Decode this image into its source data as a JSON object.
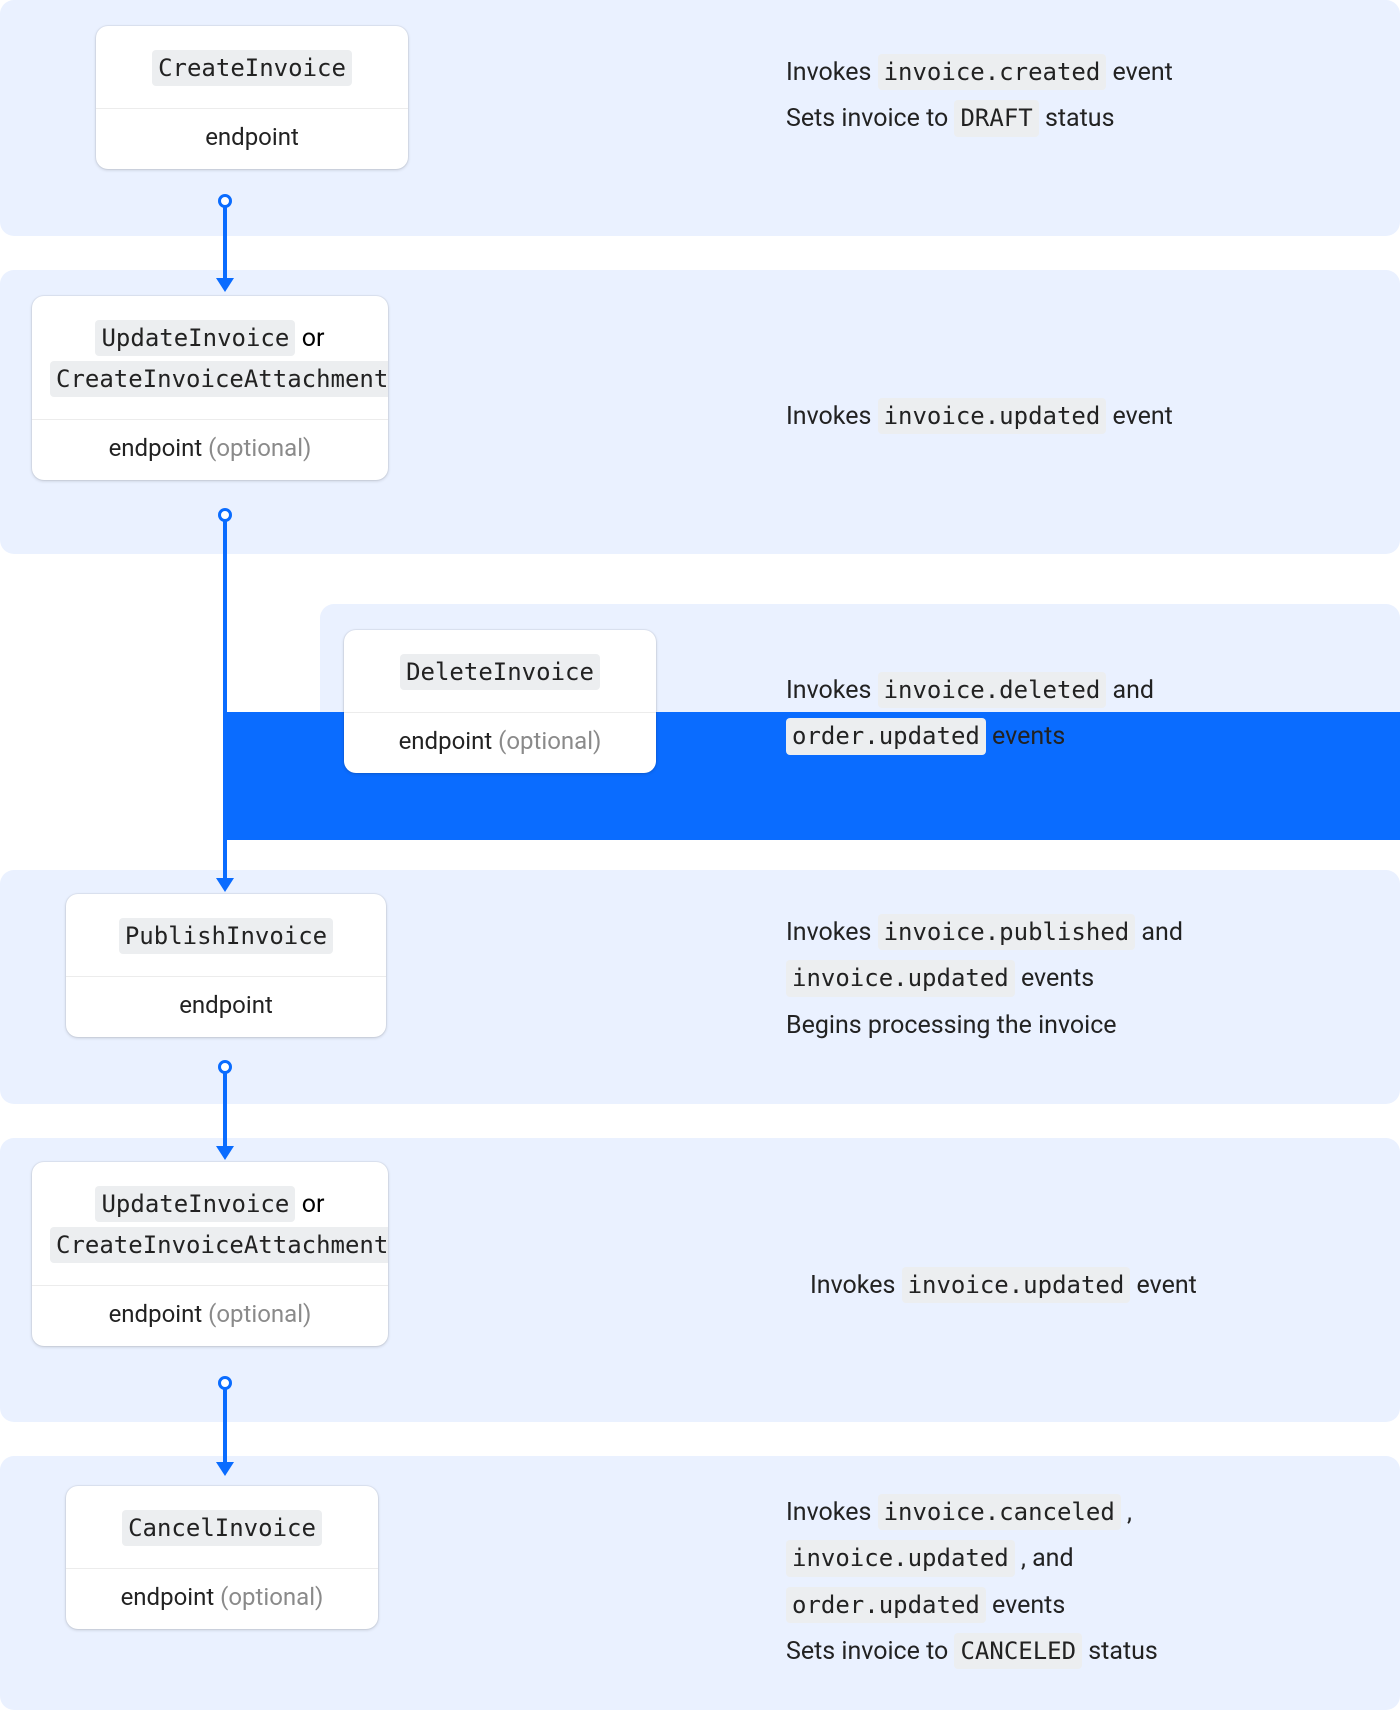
{
  "steps": {
    "s1": {
      "title_code": "CreateInvoice",
      "subtitle": "endpoint",
      "optional": "",
      "desc_pre1": "Invokes ",
      "desc_code1": "invoice.created",
      "desc_post1": " event",
      "desc_pre2": "Sets invoice to ",
      "desc_code2": "DRAFT",
      "desc_post2": " status"
    },
    "s2": {
      "title_code_a": "UpdateInvoice",
      "or": " or",
      "title_code_b": "CreateInvoiceAttachment",
      "subtitle_label": "endpoint",
      "optional": " (optional)",
      "desc_pre1": "Invokes ",
      "desc_code1": "invoice.updated",
      "desc_post1": " event"
    },
    "s3": {
      "title_code": "DeleteInvoice",
      "subtitle_label": "endpoint",
      "optional": " (optional)",
      "desc_pre1": "Invokes ",
      "desc_code1": "invoice.deleted",
      "desc_post1": " and",
      "desc_code2": "order.updated",
      "desc_post2": " events"
    },
    "s4": {
      "title_code": "PublishInvoice",
      "subtitle_label": "endpoint",
      "optional": "",
      "desc_pre1": "Invokes ",
      "desc_code1": "invoice.published",
      "desc_post1": " and",
      "desc_code2": "invoice.updated",
      "desc_post2": " events",
      "desc_line3": "Begins processing the invoice"
    },
    "s5": {
      "title_code_a": "UpdateInvoice",
      "or": " or",
      "title_code_b": "CreateInvoiceAttachment",
      "subtitle_label": "endpoint",
      "optional": " (optional)",
      "desc_pre1": "Invokes ",
      "desc_code1": "invoice.updated",
      "desc_post1": " event"
    },
    "s6": {
      "title_code": "CancelInvoice",
      "subtitle_label": "endpoint",
      "optional": " (optional)",
      "desc_pre1": "Invokes ",
      "desc_code1": "invoice.canceled",
      "desc_post1": " ,",
      "desc_code2": "invoice.updated",
      "desc_post2": " , and",
      "desc_code3": "order.updated",
      "desc_post3": " events",
      "desc_pre4": "Sets invoice to ",
      "desc_code4": "CANCELED",
      "desc_post4": " status"
    }
  }
}
